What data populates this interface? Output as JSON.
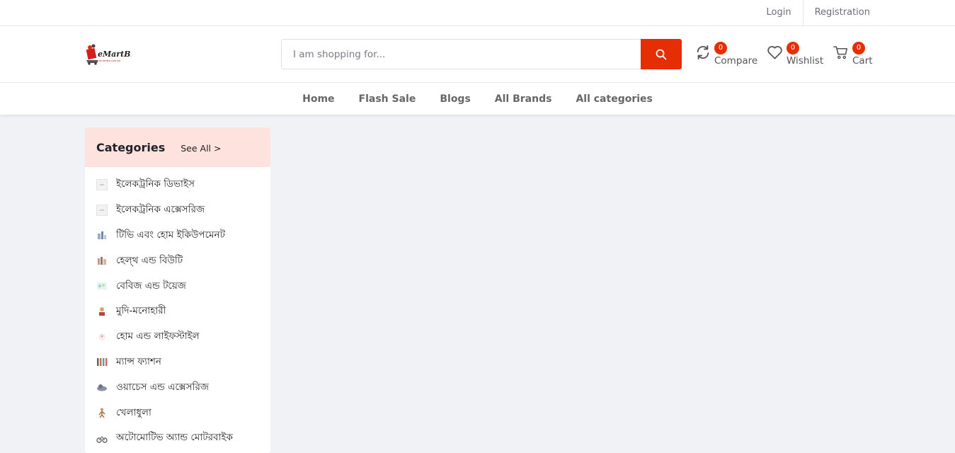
{
  "topbar": {
    "login": "Login",
    "registration": "Registration"
  },
  "logo": {
    "text": "eMartBD",
    "sub": "emartbd.com.bd"
  },
  "search": {
    "placeholder": "I am shopping for..."
  },
  "header_icons": {
    "compare": {
      "label": "Compare",
      "count": "0",
      "icon": "refresh-icon"
    },
    "wishlist": {
      "label": "Wishlist",
      "count": "0",
      "icon": "heart-icon"
    },
    "cart": {
      "label": "Cart",
      "count": "0",
      "icon": "cart-icon"
    }
  },
  "nav": [
    "Home",
    "Flash Sale",
    "Blogs",
    "All Brands",
    "All categories"
  ],
  "categories": {
    "title": "Categories",
    "see_all": "See All >",
    "items": [
      "ইলেকট্রনিক ডিভাইস",
      "ইলেকট্রনিক এক্সেসরিজ",
      "টিভি এবং হোম ইকিউপমেনট",
      "হেল্থ এন্ড বিউটি",
      "বেবিজ এন্ড টয়েজ",
      "মুদি-মনোহারী",
      "হোম এন্ড লাইফস্টাইল",
      "ম্যান্স ফ্যাশন",
      "ওয়াচেস এন্ড এক্সেসরিজ",
      "খেলাধুলা",
      "অটোমোটিভ অ্যান্ড মোটরবাইক"
    ]
  },
  "colors": {
    "accent": "#e62e04",
    "category_header": "#fde2de",
    "page_bg": "#f1f2f6"
  }
}
